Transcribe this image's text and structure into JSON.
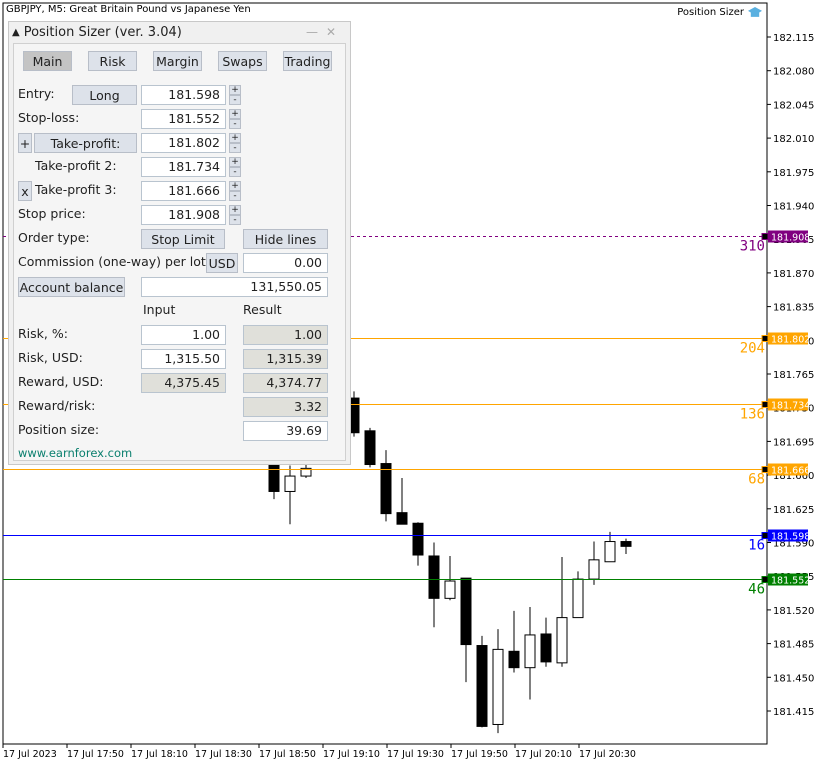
{
  "chart_title": "GBPJPY, M5:  Great Britain Pound vs Japanese Yen",
  "indicator_label": "Position Sizer",
  "indicator_icon": "graduation-cap-icon",
  "price_axis": [
    "182.115",
    "182.080",
    "182.045",
    "182.010",
    "181.975",
    "181.940",
    "181.905",
    "181.870",
    "181.835",
    "181.800",
    "181.765",
    "181.730",
    "181.695",
    "181.660",
    "181.625",
    "181.590",
    "181.555",
    "181.520",
    "181.485",
    "181.450",
    "181.415"
  ],
  "time_axis": [
    "17 Jul 2023",
    "17 Jul 17:50",
    "17 Jul 18:10",
    "17 Jul 18:30",
    "17 Jul 18:50",
    "17 Jul 19:10",
    "17 Jul 19:30",
    "17 Jul 19:50",
    "17 Jul 20:10",
    "17 Jul 20:30"
  ],
  "levels": [
    {
      "name": "stop-price",
      "price": "181.908",
      "points": "310",
      "color": "#800080",
      "dashed": true
    },
    {
      "name": "take-profit",
      "price": "181.802",
      "points": "204",
      "color": "#ffa500"
    },
    {
      "name": "take-profit-2",
      "price": "181.734",
      "points": "136",
      "color": "#ffa500"
    },
    {
      "name": "take-profit-3",
      "price": "181.666",
      "points": "68",
      "color": "#ffa500"
    },
    {
      "name": "entry",
      "price": "181.598",
      "points": "16",
      "color": "#0000ff"
    },
    {
      "name": "stop-loss",
      "price": "181.552",
      "points": "46",
      "color": "#008000"
    }
  ],
  "candles": [
    [
      181.675,
      181.69,
      181.635,
      181.643
    ],
    [
      181.643,
      181.67,
      181.609,
      181.659
    ],
    [
      181.659,
      181.69,
      181.657,
      181.667
    ],
    [
      0,
      0,
      0,
      0
    ],
    [
      0,
      0,
      0,
      0
    ],
    [
      181.74,
      181.747,
      181.7,
      181.704
    ],
    [
      181.706,
      181.709,
      181.668,
      181.671
    ],
    [
      181.672,
      181.686,
      181.612,
      181.62
    ],
    [
      181.621,
      181.657,
      181.609,
      181.609
    ],
    [
      181.61,
      181.611,
      181.566,
      181.577
    ],
    [
      181.576,
      181.59,
      181.502,
      181.532
    ],
    [
      181.532,
      181.576,
      181.53,
      181.55
    ],
    [
      181.553,
      181.553,
      181.445,
      181.484
    ],
    [
      181.483,
      181.493,
      181.398,
      181.399
    ],
    [
      181.401,
      181.5,
      181.392,
      181.479
    ],
    [
      181.477,
      181.519,
      181.455,
      181.46
    ],
    [
      181.46,
      181.523,
      181.427,
      181.494
    ],
    [
      181.495,
      181.512,
      181.461,
      181.466
    ],
    [
      181.465,
      181.575,
      181.461,
      181.512
    ],
    [
      181.512,
      181.56,
      181.512,
      181.552
    ],
    [
      181.552,
      181.591,
      181.546,
      181.572
    ],
    [
      181.57,
      181.601,
      181.57,
      181.591
    ],
    [
      181.591,
      181.594,
      181.578,
      181.586
    ]
  ],
  "panel": {
    "title": "Position Sizer (ver. 3.04)",
    "tabs": [
      "Main",
      "Risk",
      "Margin",
      "Swaps",
      "Trading"
    ],
    "entry_label": "Entry:",
    "direction": "Long",
    "entry": "181.598",
    "sl_label": "Stop-loss:",
    "sl": "181.552",
    "tp_add": "+",
    "tp_label": "Take-profit:",
    "tp": "181.802",
    "tp2_label": "Take-profit 2:",
    "tp2": "181.734",
    "tp3_remove": "x",
    "tp3_label": "Take-profit 3:",
    "tp3": "181.666",
    "sp_label": "Stop price:",
    "sp": "181.908",
    "plus": "+",
    "minus": "-",
    "order_type_label": "Order type:",
    "order_type": "Stop Limit",
    "hide_lines": "Hide lines",
    "commission_label": "Commission (one-way) per lot:",
    "commission_currency": "USD",
    "commission": "0.00",
    "account_balance_label": "Account balance",
    "account_balance": "131,550.05",
    "col_input": "Input",
    "col_result": "Result",
    "risk_pct_label": "Risk, %:",
    "risk_pct_in": "1.00",
    "risk_pct_res": "1.00",
    "risk_usd_label": "Risk, USD:",
    "risk_usd_in": "1,315.50",
    "risk_usd_res": "1,315.39",
    "reward_label": "Reward, USD:",
    "reward_in": "4,375.45",
    "reward_res": "4,374.77",
    "rr_label": "Reward/risk:",
    "rr": "3.32",
    "size_label": "Position size:",
    "size": "39.69",
    "link": "www.earnforex.com"
  }
}
